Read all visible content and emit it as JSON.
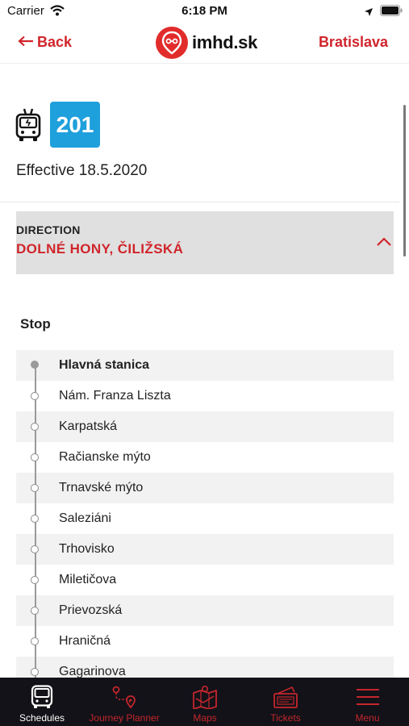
{
  "status_bar": {
    "carrier": "Carrier",
    "time": "6:18 PM"
  },
  "nav": {
    "back_label": "Back",
    "logo_text": "imhd.sk",
    "city": "Bratislava"
  },
  "line": {
    "number": "201",
    "effective": "Effective 18.5.2020",
    "vehicle_icon": "trolleybus-icon",
    "badge_color": "#1ea0dc"
  },
  "direction": {
    "label": "DIRECTION",
    "value": "DOLNÉ HONY, ČILIŽSKÁ"
  },
  "stops_header": "Stop",
  "stops": [
    "Hlavná stanica",
    "Nám. Franza Liszta",
    "Karpatská",
    "Račianske mýto",
    "Trnavské mýto",
    "Saleziáni",
    "Trhovisko",
    "Miletičova",
    "Prievozská",
    "Hraničná",
    "Gagarinova"
  ],
  "tabs": [
    {
      "label": "Schedules",
      "icon": "bus-icon",
      "active": true
    },
    {
      "label": "Journey Planner",
      "icon": "route-icon",
      "active": false
    },
    {
      "label": "Maps",
      "icon": "map-icon",
      "active": false
    },
    {
      "label": "Tickets",
      "icon": "ticket-icon",
      "active": false
    },
    {
      "label": "Menu",
      "icon": "hamburger-menu-icon",
      "active": false
    }
  ],
  "colors": {
    "accent": "#d0252b",
    "tabbar": "#121218",
    "direction_bg": "#e0e0e0"
  }
}
